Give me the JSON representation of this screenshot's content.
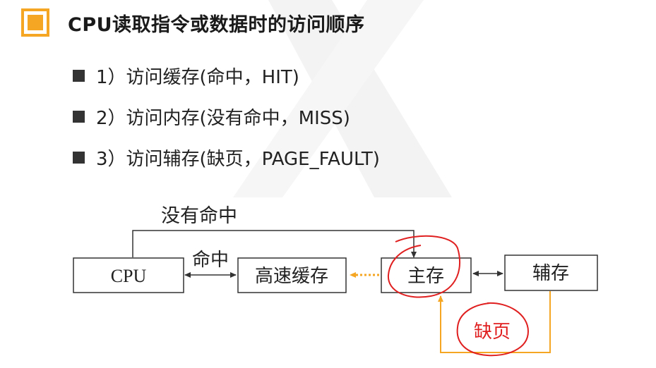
{
  "title": "CPU读取指令或数据时的访问顺序",
  "bullets": [
    "1）访问缓存(命中，HIT)",
    "2）访问内存(没有命中，MISS)",
    "3）访问辅存(缺页，PAGE_FAULT)"
  ],
  "diagram": {
    "nodes": {
      "cpu": "CPU",
      "cache": "高速缓存",
      "main_memory": "主存",
      "secondary_storage": "辅存"
    },
    "labels": {
      "hit": "命中",
      "miss": "没有命中",
      "page_fault": "缺页"
    }
  },
  "colors": {
    "accent": "#f5a623",
    "annotation": "#e02020",
    "box_border": "#333333",
    "page_fault_path": "#f5a623"
  }
}
